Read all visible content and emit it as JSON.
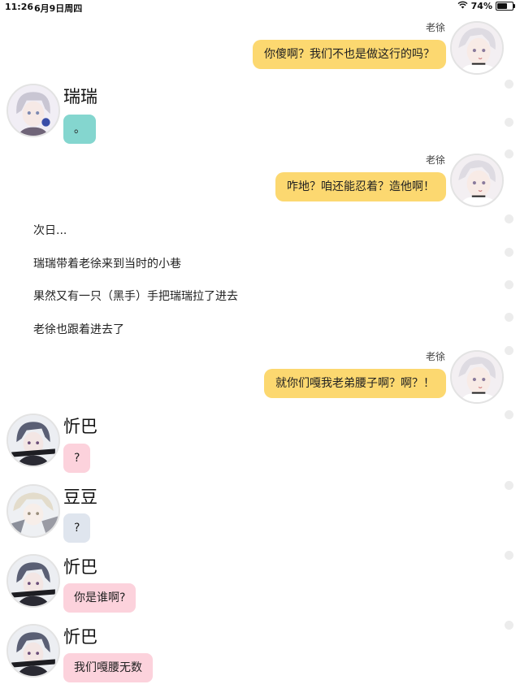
{
  "status_bar": {
    "time": "11:26",
    "date": "6月9日周四",
    "battery_percent": "74%",
    "battery_level": 0.74,
    "wifi_icon": "wifi-icon"
  },
  "colors": {
    "outgoing_bubble": "#fcd870",
    "teal_bubble": "#84d6cf",
    "pink_bubble": "#fcd2dc",
    "blue_bubble": "#dfe5ee"
  },
  "messages": [
    {
      "type": "outgoing",
      "sender": "老徐",
      "text": "你傻啊？我们不也是做这行的吗？"
    },
    {
      "type": "incoming",
      "sender": "瑞瑞",
      "text": "。",
      "bubble_color": "#84d6cf"
    },
    {
      "type": "outgoing",
      "sender": "老徐",
      "text": "咋地？咱还能忍着？造他啊！"
    },
    {
      "type": "narration",
      "text": "次日..."
    },
    {
      "type": "narration",
      "text": "瑞瑞带着老徐来到当时的小巷"
    },
    {
      "type": "narration",
      "text": "果然又有一只（黑手）手把瑞瑞拉了进去"
    },
    {
      "type": "narration",
      "text": "老徐也跟着进去了"
    },
    {
      "type": "outgoing",
      "sender": "老徐",
      "text": "就你们嘎我老弟腰子啊？啊？！"
    },
    {
      "type": "incoming",
      "sender": "忻巴",
      "text": "?",
      "bubble_color": "#fcd2dc"
    },
    {
      "type": "incoming",
      "sender": "豆豆",
      "text": "?",
      "bubble_color": "#dfe5ee"
    },
    {
      "type": "incoming",
      "sender": "忻巴",
      "text": "你是谁啊?",
      "bubble_color": "#fcd2dc"
    },
    {
      "type": "incoming",
      "sender": "忻巴",
      "text": "我们嘎腰无数",
      "bubble_color": "#fcd2dc"
    }
  ]
}
